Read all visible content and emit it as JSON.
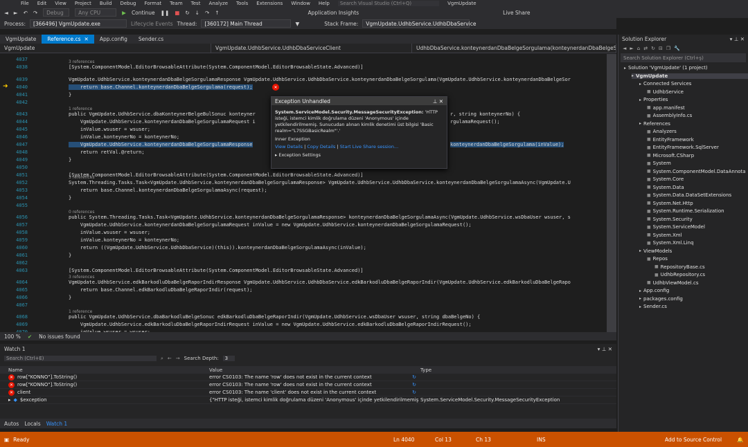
{
  "menu": [
    "File",
    "Edit",
    "View",
    "Project",
    "Build",
    "Debug",
    "Format",
    "Team",
    "Test",
    "Analyze",
    "Tools",
    "Extensions",
    "Window",
    "Help"
  ],
  "menu_search_placeholder": "Search Visual Studio (Ctrl+Q)",
  "app_title": "VgmUpdate",
  "toolbar": {
    "config": "Debug",
    "platform": "Any CPU",
    "continue": "Continue",
    "app_insights": "Application Insights",
    "live_share": "Live Share"
  },
  "debug_bar": {
    "process_label": "Process:",
    "process": "[366496] VgmUpdate.exe",
    "lifecycle": "Lifecycle Events",
    "thread_label": "Thread:",
    "thread": "[360172] Main Thread",
    "stack_label": "Stack Frame:",
    "stack": "VgmUpdate.UdhbService.UdhbDbaService"
  },
  "tabs": [
    {
      "label": "VgmUpdate",
      "active": false
    },
    {
      "label": "Reference.cs",
      "active": true
    },
    {
      "label": "App.config",
      "active": false
    },
    {
      "label": "Sender.cs",
      "active": false
    }
  ],
  "nav": [
    "VgmUpdate",
    "VgmUpdate.UdhbService.UdhbDbaServiceClient",
    "UdhbDbaService.konteynerdanDbaBelgeSorgulama(konteynerdanDbaBelgeSorg"
  ],
  "editor": {
    "lines": [
      {
        "n": "4037",
        "t": ""
      },
      {
        "n": "4038",
        "t": "[System.ComponentModel.EditorBrowsableAttribute(System.ComponentModel.EditorBrowsableState.Advanced)]",
        "lens": "3 references"
      },
      {
        "n": "4039",
        "t": "VgmUpdate.UdhbService.konteynerdanDbaBelgeSorgulamaResponse VgmUpdate.UdhbService.UdhbDbaService.konteynerdanDbaBelgeSorgulama(VgmUpdate.UdhbService.konteynerdanDbaBelgeSor"
      },
      {
        "n": "4040",
        "t": "    return base.Channel.konteynerdanDbaBelgeSorgulama(request);",
        "hl": true
      },
      {
        "n": "4041",
        "t": "}"
      },
      {
        "n": "4042",
        "t": ""
      },
      {
        "n": "4043",
        "t": "public VgmUpdate.UdhbService.dbaKonteynerBelgeBulSonuc konteyner",
        "lens": "1 reference",
        "tail": "r, string konteynerNo) {"
      },
      {
        "n": "4044",
        "t": "    VgmUpdate.UdhbService.konteynerdanDbaBelgeSorgulamaRequest i",
        "tail": "rgulamaRequest();"
      },
      {
        "n": "4045",
        "t": "    inValue.wsuser = wsuser;"
      },
      {
        "n": "4046",
        "t": "    inValue.konteynerNo = konteynerNo;"
      },
      {
        "n": "4047",
        "t": "    VgmUpdate.UdhbService.konteynerdanDbaBelgeSorgulamaResponse",
        "tail": "konteynerdanDbaBelgeSorgulama(inValue);",
        "hl": true
      },
      {
        "n": "4048",
        "t": "    return retVal.@return;"
      },
      {
        "n": "4049",
        "t": "}"
      },
      {
        "n": "4050",
        "t": ""
      },
      {
        "n": "4051",
        "t": "[System.ComponentModel.EditorBrowsableAttribute(System.ComponentModel.EditorBrowsableState.Advanced)]"
      },
      {
        "n": "4052",
        "t": "System.Threading.Tasks.Task<VgmUpdate.UdhbService.konteynerdanDbaBelgeSorgulamaResponse> VgmUpdate.UdhbService.UdhbDbaService.konteynerdanDbaBelgeSorgulamaAsync(VgmUpdate.U",
        "lens": "3 references"
      },
      {
        "n": "4053",
        "t": "    return base.Channel.konteynerdanDbaBelgeSorgulamaAsync(request);"
      },
      {
        "n": "4054",
        "t": "}"
      },
      {
        "n": "4055",
        "t": ""
      },
      {
        "n": "4056",
        "t": "public System.Threading.Tasks.Task<VgmUpdate.UdhbService.konteynerdanDbaBelgeSorgulamaResponse> konteynerdanDbaBelgeSorgulamaAsync(VgmUpdate.UdhbService.wsDbaUser wsuser, s",
        "lens": "0 references"
      },
      {
        "n": "4057",
        "t": "    VgmUpdate.UdhbService.konteynerdanDbaBelgeSorgulamaRequest inValue = new VgmUpdate.UdhbService.konteynerdanDbaBelgeSorgulamaRequest();"
      },
      {
        "n": "4058",
        "t": "    inValue.wsuser = wsuser;"
      },
      {
        "n": "4059",
        "t": "    inValue.konteynerNo = konteynerNo;"
      },
      {
        "n": "4060",
        "t": "    return ((VgmUpdate.UdhbService.UdhbDbaService)(this)).konteynerdanDbaBelgeSorgulamaAsync(inValue);"
      },
      {
        "n": "4061",
        "t": "}"
      },
      {
        "n": "4062",
        "t": ""
      },
      {
        "n": "4063",
        "t": "[System.ComponentModel.EditorBrowsableAttribute(System.ComponentModel.EditorBrowsableState.Advanced)]"
      },
      {
        "n": "4064",
        "t": "VgmUpdate.UdhbService.edkBarkodluDbaBelgeRaporIndirResponse VgmUpdate.UdhbService.UdhbDbaService.edkBarkodluDbaBelgeRaporIndir(VgmUpdate.UdhbService.edkBarkodluDbaBelgeRapo",
        "lens": "3 references"
      },
      {
        "n": "4065",
        "t": "    return base.Channel.edkBarkodluDbaBelgeRaporIndir(request);"
      },
      {
        "n": "4066",
        "t": "}"
      },
      {
        "n": "4067",
        "t": ""
      },
      {
        "n": "4068",
        "t": "public VgmUpdate.UdhbService.dbaBarkodluBelgeSonuc edkBarkodluDbaBelgeRaporIndir(VgmUpdate.UdhbService.wsDbaUser wsuser, string dbaBelgeNo) {",
        "lens": "1 reference"
      },
      {
        "n": "4069",
        "t": "    VgmUpdate.UdhbService.edkBarkodluDbaBelgeRaporIndirRequest inValue = new VgmUpdate.UdhbService.edkBarkodluDbaBelgeRaporIndirRequest();"
      },
      {
        "n": "4070",
        "t": "    inValue.wsuser = wsuser;"
      }
    ]
  },
  "exception": {
    "title": "Exception Unhandled",
    "type": "System.ServiceModel.Security.MessageSecurityException:",
    "message": "'HTTP isteği, istemci kimlik doğrulama düzeni 'Anonymous' içinde yetkilendirilmemiş. Sunucudan alınan kimlik denetimi üst bilgisi 'Basic realm=\"L7SSGBasicRealm\"'.'",
    "inner": "Inner Exception",
    "links": [
      "View Details",
      "Copy Details",
      "Start Live Share session..."
    ],
    "settings": "Exception Settings"
  },
  "editor_footer": {
    "zoom": "100 %",
    "issues": "No issues found"
  },
  "watch": {
    "title": "Watch 1",
    "search_placeholder": "Search (Ctrl+E)",
    "depth_label": "Search Depth:",
    "depth": "3",
    "headers": [
      "Name",
      "Value",
      "Type"
    ],
    "rows": [
      {
        "name": "row[\"KONNO\"].ToString()",
        "value": "error CS0103: The name 'row' does not exist in the current context",
        "type": "",
        "icon": "error"
      },
      {
        "name": "row[\"KONNO\"].ToString()",
        "value": "error CS0103: The name 'row' does not exist in the current context",
        "type": "",
        "icon": "error"
      },
      {
        "name": "client",
        "value": "error CS0103: The name 'client' does not exist in the current context",
        "type": "",
        "icon": "error"
      },
      {
        "name": "$exception",
        "value": "{\"HTTP isteği, istemci kimlik doğrulama düzeni 'Anonymous' içinde yetkilendirilmemiş.",
        "type": "System.ServiceModel.Security.MessageSecurityException",
        "icon": "exception"
      }
    ]
  },
  "bottom_tabs": [
    "Autos",
    "Locals",
    "Watch 1"
  ],
  "status": {
    "state": "Ready",
    "ln": "Ln 4040",
    "col": "Col 13",
    "ch": "Ch 13",
    "mode": "INS",
    "source": "Add to Source Control"
  },
  "solution_explorer": {
    "title": "Solution Explorer",
    "search_placeholder": "Search Solution Explorer (Ctrl+ş)",
    "nodes": [
      {
        "label": "Solution 'VgmUpdate' (1 project)",
        "lvl": 0
      },
      {
        "label": "VgmUpdate",
        "lvl": 1,
        "bold": true,
        "sel": true
      },
      {
        "label": "Connected Services",
        "lvl": 2
      },
      {
        "label": "UdhbService",
        "lvl": 3
      },
      {
        "label": "Properties",
        "lvl": 2
      },
      {
        "label": "app.manifest",
        "lvl": 3
      },
      {
        "label": "AssemblyInfo.cs",
        "lvl": 3
      },
      {
        "label": "References",
        "lvl": 2
      },
      {
        "label": "Analyzers",
        "lvl": 3
      },
      {
        "label": "EntityFramework",
        "lvl": 3
      },
      {
        "label": "EntityFramework.SqlServer",
        "lvl": 3
      },
      {
        "label": "Microsoft.CSharp",
        "lvl": 3
      },
      {
        "label": "System",
        "lvl": 3
      },
      {
        "label": "System.ComponentModel.DataAnnota",
        "lvl": 3
      },
      {
        "label": "System.Core",
        "lvl": 3
      },
      {
        "label": "System.Data",
        "lvl": 3
      },
      {
        "label": "System.Data.DataSetExtensions",
        "lvl": 3
      },
      {
        "label": "System.Net.Http",
        "lvl": 3
      },
      {
        "label": "System.Runtime.Serialization",
        "lvl": 3
      },
      {
        "label": "System.Security",
        "lvl": 3
      },
      {
        "label": "System.ServiceModel",
        "lvl": 3
      },
      {
        "label": "System.Xml",
        "lvl": 3
      },
      {
        "label": "System.Xml.Linq",
        "lvl": 3
      },
      {
        "label": "ViewModels",
        "lvl": 2
      },
      {
        "label": "Repos",
        "lvl": 3
      },
      {
        "label": "RepositoryBase.cs",
        "lvl": 4
      },
      {
        "label": "UdhbRepository.cs",
        "lvl": 4
      },
      {
        "label": "UdhbViewModel.cs",
        "lvl": 3
      },
      {
        "label": "App.config",
        "lvl": 2
      },
      {
        "label": "packages.config",
        "lvl": 2
      },
      {
        "label": "Sender.cs",
        "lvl": 2
      }
    ]
  },
  "colors": {
    "accent": "#007acc",
    "status_bar": "#ca5100",
    "error": "#e51400"
  }
}
